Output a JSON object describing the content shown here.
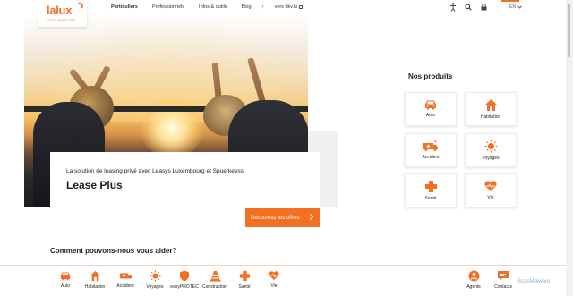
{
  "brand": {
    "name": "lalux",
    "tagline": "ASSURANCES"
  },
  "nav": {
    "items": [
      "Particuliers",
      "Professionnels",
      "Infos & outils",
      "Blog"
    ],
    "separator": "›",
    "external_link": "vers dkv.lu"
  },
  "header": {
    "language": "EN"
  },
  "hero": {
    "subtitle": "La solution de leasing privé avec Leasys Luxembourg et Spuerkeess",
    "title": "Lease Plus",
    "cta": "Découvrez les offres"
  },
  "products": {
    "title": "Nos produits",
    "items": [
      "Auto",
      "Habitation",
      "Accident",
      "Voyages",
      "Santé",
      "Vie"
    ]
  },
  "help": {
    "title": "Comment pouvons-nous vous aider?"
  },
  "bottom_bar": {
    "items": [
      "Auto",
      "Habitation",
      "Accident",
      "Voyages",
      "easyPROTEC",
      "Construction",
      "Santé",
      "Vie"
    ],
    "right": [
      "Agents",
      "Contacts"
    ]
  },
  "watermark": "ScanMalware",
  "colors": {
    "accent": "#f36f21",
    "text": "#222222",
    "page_bg": "#ffffff"
  },
  "icons": {
    "header": [
      "accessibility-icon",
      "search-icon",
      "lock-icon",
      "menu-icon"
    ],
    "products": [
      "car-icon",
      "house-icon",
      "ambulance-icon",
      "sun-icon",
      "health-cross-icon",
      "heart-icon"
    ]
  }
}
